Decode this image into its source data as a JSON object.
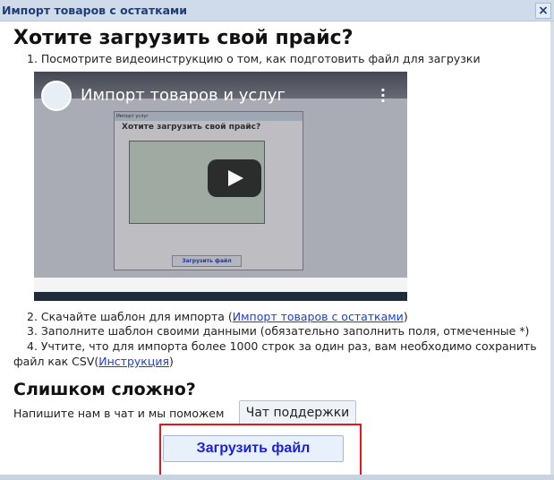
{
  "dialog": {
    "title": "Импорт товаров с остатками",
    "close_icon": "×"
  },
  "heading": "Хотите загрузить свой прайс?",
  "steps": {
    "s1": "1. Посмотрите видеоинструкцию о том, как подготовить файл для загрузки",
    "s2_pre": "2. Скачайте шаблон для импорта (",
    "s2_link": "Импорт товаров с остатками",
    "s2_post": ")",
    "s3": "3. Заполните шаблон своими данными (обязательно заполнить поля, отмеченные *)",
    "s4_line1": "4. Учтите, что для импорта более 1000 строк за один раз, вам необходимо сохранить",
    "s4_pre": "файл как CSV(",
    "s4_link": "Инструкция",
    "s4_post": ")"
  },
  "video": {
    "title": "Импорт товаров и услуг",
    "inner_dialog_title": "Импорт услуг",
    "inner_heading": "Хотите загрузить свой прайс?",
    "inner_button": "Загрузить файл"
  },
  "help": {
    "heading": "Слишком сложно?",
    "text": "Напишите нам в чат и мы поможем",
    "chat_button": "Чат поддержки"
  },
  "upload_button": "Загрузить файл"
}
